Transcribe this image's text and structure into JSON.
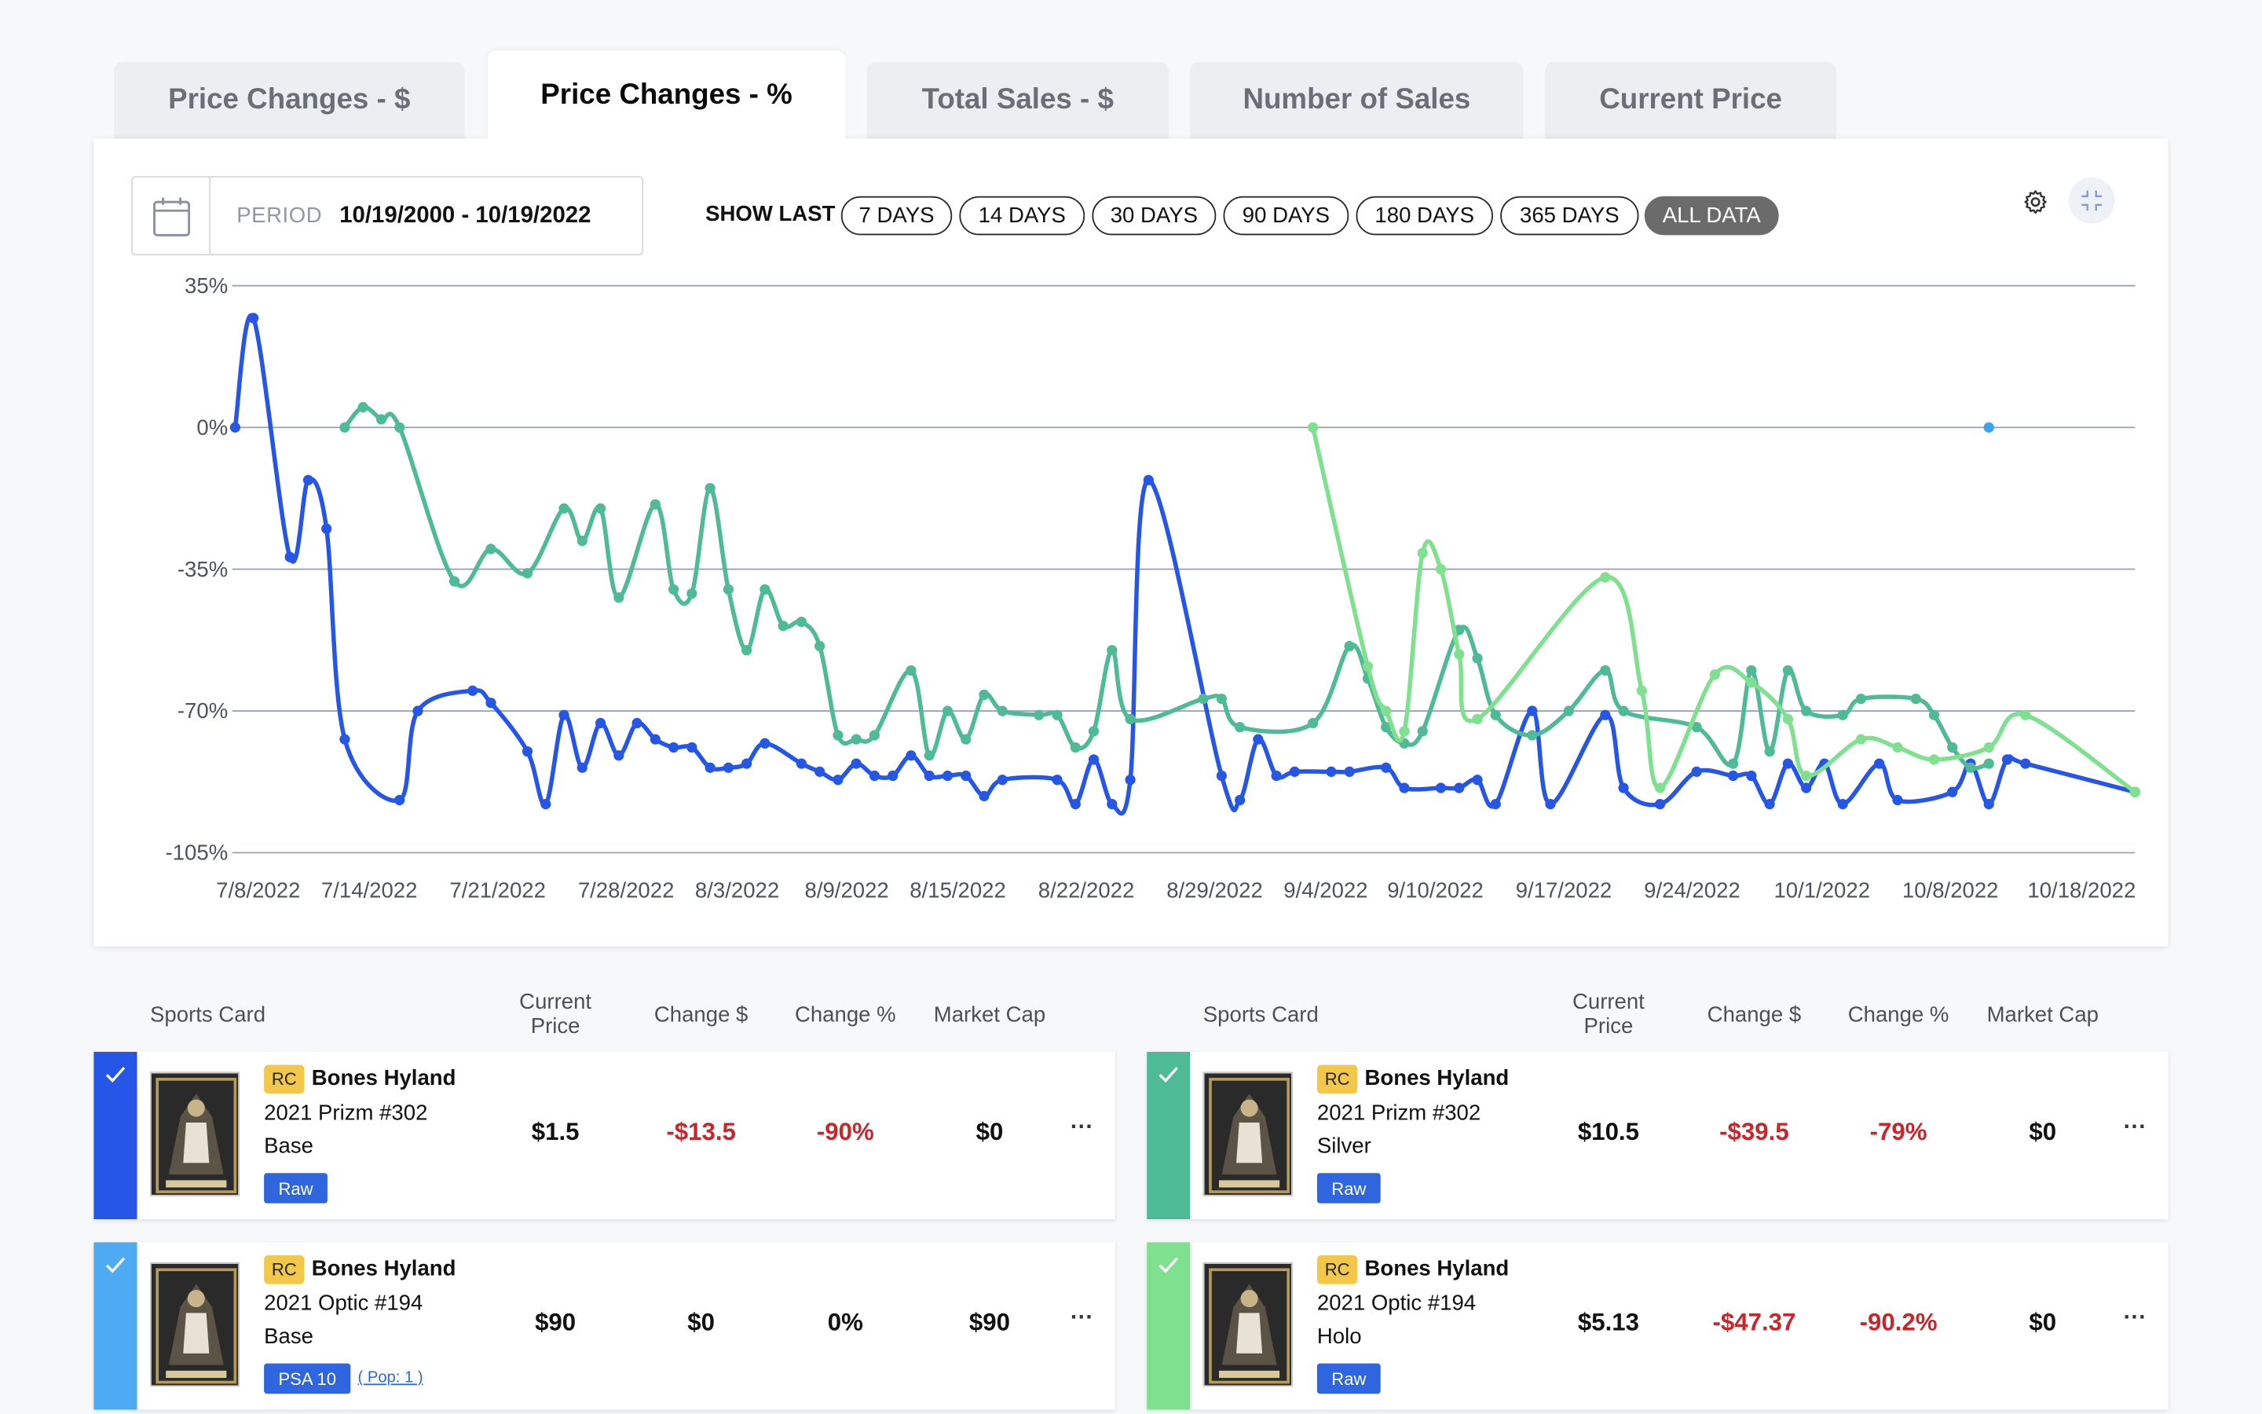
{
  "tabs": [
    {
      "label": "Price Changes - $",
      "active": false
    },
    {
      "label": "Price Changes - %",
      "active": true
    },
    {
      "label": "Total Sales - $",
      "active": false
    },
    {
      "label": "Number of Sales",
      "active": false
    },
    {
      "label": "Current Price",
      "active": false
    }
  ],
  "controls": {
    "period_label": "PERIOD",
    "period_value": "10/19/2000 - 10/19/2022",
    "show_last_label": "SHOW LAST",
    "ranges": [
      "7 DAYS",
      "14 DAYS",
      "30 DAYS",
      "90 DAYS",
      "180 DAYS",
      "365 DAYS",
      "ALL DATA"
    ],
    "active_range": "ALL DATA"
  },
  "icons": {
    "calendar": "calendar-icon",
    "settings": "gear-icon",
    "fullscreen": "fullscreen-icon",
    "check": "check-icon",
    "more": "more-icon"
  },
  "chart_data": {
    "type": "line",
    "x_tick_labels": [
      "7/8/2022",
      "7/14/2022",
      "7/21/2022",
      "7/28/2022",
      "8/3/2022",
      "8/9/2022",
      "8/15/2022",
      "8/22/2022",
      "8/29/2022",
      "9/4/2022",
      "9/10/2022",
      "9/17/2022",
      "9/24/2022",
      "10/1/2022",
      "10/8/2022",
      "10/18/2022"
    ],
    "y_tick_labels": [
      "35%",
      "0%",
      "-35%",
      "-70%",
      "-105%"
    ],
    "ylim": [
      -105,
      35
    ],
    "xlim": [
      "2022-07-07",
      "2022-10-19"
    ],
    "grid": true,
    "series": [
      {
        "color": "#2556e8",
        "points": [
          [
            "2022-07-07",
            0
          ],
          [
            "2022-07-08",
            27
          ],
          [
            "2022-07-10",
            -32
          ],
          [
            "2022-07-11",
            -13
          ],
          [
            "2022-07-12",
            -25
          ],
          [
            "2022-07-13",
            -77
          ],
          [
            "2022-07-16",
            -92
          ],
          [
            "2022-07-17",
            -70
          ],
          [
            "2022-07-20",
            -65
          ],
          [
            "2022-07-21",
            -68
          ],
          [
            "2022-07-23",
            -80
          ],
          [
            "2022-07-24",
            -93
          ],
          [
            "2022-07-25",
            -71
          ],
          [
            "2022-07-26",
            -84
          ],
          [
            "2022-07-27",
            -73
          ],
          [
            "2022-07-28",
            -81
          ],
          [
            "2022-07-29",
            -73
          ],
          [
            "2022-07-30",
            -77
          ],
          [
            "2022-07-31",
            -79
          ],
          [
            "2022-08-01",
            -79
          ],
          [
            "2022-08-02",
            -84
          ],
          [
            "2022-08-03",
            -84
          ],
          [
            "2022-08-04",
            -83
          ],
          [
            "2022-08-05",
            -78
          ],
          [
            "2022-08-07",
            -83
          ],
          [
            "2022-08-08",
            -85
          ],
          [
            "2022-08-09",
            -87
          ],
          [
            "2022-08-10",
            -83
          ],
          [
            "2022-08-11",
            -86
          ],
          [
            "2022-08-12",
            -86
          ],
          [
            "2022-08-13",
            -81
          ],
          [
            "2022-08-14",
            -86
          ],
          [
            "2022-08-15",
            -86
          ],
          [
            "2022-08-16",
            -86
          ],
          [
            "2022-08-17",
            -91
          ],
          [
            "2022-08-18",
            -87
          ],
          [
            "2022-08-21",
            -87
          ],
          [
            "2022-08-22",
            -93
          ],
          [
            "2022-08-23",
            -82
          ],
          [
            "2022-08-24",
            -93
          ],
          [
            "2022-08-25",
            -87
          ],
          [
            "2022-08-26",
            -13
          ],
          [
            "2022-08-30",
            -86
          ],
          [
            "2022-08-31",
            -92
          ],
          [
            "2022-09-01",
            -77
          ],
          [
            "2022-09-02",
            -86
          ],
          [
            "2022-09-03",
            -85
          ],
          [
            "2022-09-05",
            -85
          ],
          [
            "2022-09-06",
            -85
          ],
          [
            "2022-09-08",
            -84
          ],
          [
            "2022-09-09",
            -89
          ],
          [
            "2022-09-11",
            -89
          ],
          [
            "2022-09-12",
            -89
          ],
          [
            "2022-09-13",
            -87
          ],
          [
            "2022-09-14",
            -93
          ],
          [
            "2022-09-16",
            -70
          ],
          [
            "2022-09-17",
            -93
          ],
          [
            "2022-09-20",
            -71
          ],
          [
            "2022-09-21",
            -89
          ],
          [
            "2022-09-23",
            -93
          ],
          [
            "2022-09-25",
            -85
          ],
          [
            "2022-09-27",
            -86
          ],
          [
            "2022-09-28",
            -86
          ],
          [
            "2022-09-29",
            -93
          ],
          [
            "2022-09-30",
            -83
          ],
          [
            "2022-10-01",
            -89
          ],
          [
            "2022-10-02",
            -83
          ],
          [
            "2022-10-03",
            -93
          ],
          [
            "2022-10-05",
            -83
          ],
          [
            "2022-10-06",
            -92
          ],
          [
            "2022-10-09",
            -90
          ],
          [
            "2022-10-10",
            -83
          ],
          [
            "2022-10-11",
            -93
          ],
          [
            "2022-10-12",
            -82
          ],
          [
            "2022-10-13",
            -83
          ],
          [
            "2022-10-19",
            -90
          ]
        ]
      },
      {
        "color": "#4fbb96",
        "points": [
          [
            "2022-07-13",
            0
          ],
          [
            "2022-07-14",
            5
          ],
          [
            "2022-07-15",
            2
          ],
          [
            "2022-07-16",
            0
          ],
          [
            "2022-07-19",
            -38
          ],
          [
            "2022-07-21",
            -30
          ],
          [
            "2022-07-23",
            -36
          ],
          [
            "2022-07-25",
            -20
          ],
          [
            "2022-07-26",
            -28
          ],
          [
            "2022-07-27",
            -20
          ],
          [
            "2022-07-28",
            -42
          ],
          [
            "2022-07-30",
            -19
          ],
          [
            "2022-07-31",
            -40
          ],
          [
            "2022-08-01",
            -41
          ],
          [
            "2022-08-02",
            -15
          ],
          [
            "2022-08-03",
            -40
          ],
          [
            "2022-08-04",
            -55
          ],
          [
            "2022-08-05",
            -40
          ],
          [
            "2022-08-06",
            -49
          ],
          [
            "2022-08-07",
            -48
          ],
          [
            "2022-08-08",
            -54
          ],
          [
            "2022-08-09",
            -76
          ],
          [
            "2022-08-10",
            -77
          ],
          [
            "2022-08-11",
            -76
          ],
          [
            "2022-08-13",
            -60
          ],
          [
            "2022-08-14",
            -81
          ],
          [
            "2022-08-15",
            -70
          ],
          [
            "2022-08-16",
            -77
          ],
          [
            "2022-08-17",
            -66
          ],
          [
            "2022-08-18",
            -70
          ],
          [
            "2022-08-20",
            -71
          ],
          [
            "2022-08-21",
            -71
          ],
          [
            "2022-08-22",
            -79
          ],
          [
            "2022-08-23",
            -75
          ],
          [
            "2022-08-24",
            -55
          ],
          [
            "2022-08-25",
            -72
          ],
          [
            "2022-08-29",
            -67
          ],
          [
            "2022-08-30",
            -67
          ],
          [
            "2022-08-31",
            -74
          ],
          [
            "2022-09-04",
            -73
          ],
          [
            "2022-09-06",
            -54
          ],
          [
            "2022-09-07",
            -62
          ],
          [
            "2022-09-08",
            -74
          ],
          [
            "2022-09-09",
            -78
          ],
          [
            "2022-09-10",
            -75
          ],
          [
            "2022-09-12",
            -50
          ],
          [
            "2022-09-13",
            -57
          ],
          [
            "2022-09-14",
            -71
          ],
          [
            "2022-09-16",
            -76
          ],
          [
            "2022-09-18",
            -70
          ],
          [
            "2022-09-20",
            -60
          ],
          [
            "2022-09-21",
            -70
          ],
          [
            "2022-09-25",
            -74
          ],
          [
            "2022-09-27",
            -83
          ],
          [
            "2022-09-28",
            -60
          ],
          [
            "2022-09-29",
            -80
          ],
          [
            "2022-09-30",
            -60
          ],
          [
            "2022-10-01",
            -70
          ],
          [
            "2022-10-03",
            -71
          ],
          [
            "2022-10-04",
            -67
          ],
          [
            "2022-10-07",
            -67
          ],
          [
            "2022-10-08",
            -71
          ],
          [
            "2022-10-09",
            -79
          ],
          [
            "2022-10-10",
            -84
          ],
          [
            "2022-10-11",
            -83
          ]
        ]
      },
      {
        "color": "#7fe08f",
        "points": [
          [
            "2022-09-04",
            0
          ],
          [
            "2022-09-07",
            -59
          ],
          [
            "2022-09-08",
            -70
          ],
          [
            "2022-09-09",
            -75
          ],
          [
            "2022-09-10",
            -31
          ],
          [
            "2022-09-11",
            -35
          ],
          [
            "2022-09-12",
            -56
          ],
          [
            "2022-09-13",
            -72
          ],
          [
            "2022-09-20",
            -37
          ],
          [
            "2022-09-22",
            -65
          ],
          [
            "2022-09-23",
            -89
          ],
          [
            "2022-09-26",
            -61
          ],
          [
            "2022-09-28",
            -63
          ],
          [
            "2022-09-30",
            -72
          ],
          [
            "2022-10-01",
            -86
          ],
          [
            "2022-10-04",
            -77
          ],
          [
            "2022-10-06",
            -79
          ],
          [
            "2022-10-08",
            -82
          ],
          [
            "2022-10-11",
            -79
          ],
          [
            "2022-10-13",
            -71
          ],
          [
            "2022-10-19",
            -90
          ]
        ]
      },
      {
        "color": "#3ea3ee",
        "points": [
          [
            "2022-10-11",
            0
          ]
        ]
      }
    ]
  },
  "table_headers": {
    "card": "Sports Card",
    "price_line1": "Current",
    "price_line2": "Price",
    "change_usd": "Change $",
    "change_pct": "Change %",
    "market_cap": "Market Cap"
  },
  "left_rows": [
    {
      "color": "#2556e8",
      "rc": "RC",
      "name": "Bones Hyland",
      "set": "2021 Prizm #302",
      "variant": "Base",
      "grade": "Raw",
      "pop": "",
      "price": "$1.5",
      "change_usd": "-$13.5",
      "change_pct": "-90%",
      "market_cap": "$0",
      "more": "···",
      "neg": true
    },
    {
      "color": "#4eaaf3",
      "rc": "RC",
      "name": "Bones Hyland",
      "set": "2021 Optic #194",
      "variant": "Base",
      "grade": "PSA 10",
      "pop": "( Pop: 1 )",
      "price": "$90",
      "change_usd": "$0",
      "change_pct": "0%",
      "market_cap": "$90",
      "more": "···",
      "neg": false
    }
  ],
  "right_rows": [
    {
      "color": "#4fbb96",
      "rc": "RC",
      "name": "Bones Hyland",
      "set": "2021 Prizm #302",
      "variant": "Silver",
      "grade": "Raw",
      "pop": "",
      "price": "$10.5",
      "change_usd": "-$39.5",
      "change_pct": "-79%",
      "market_cap": "$0",
      "more": "···",
      "neg": true
    },
    {
      "color": "#7fe08f",
      "rc": "RC",
      "name": "Bones Hyland",
      "set": "2021 Optic #194",
      "variant": "Holo",
      "grade": "Raw",
      "pop": "",
      "price": "$5.13",
      "change_usd": "-$47.37",
      "change_pct": "-90.2%",
      "market_cap": "$0",
      "more": "···",
      "neg": true
    }
  ]
}
